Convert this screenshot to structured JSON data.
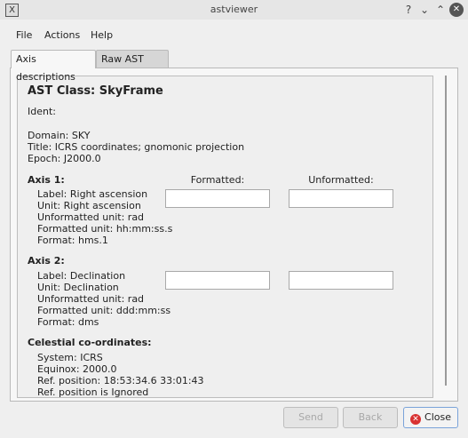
{
  "window": {
    "title": "astviewer",
    "app_icon_glyph": "X",
    "help_glyph": "?",
    "minimize_glyph": "⌄",
    "maximize_glyph": "⌃",
    "close_glyph": "✕"
  },
  "menubar": {
    "items": [
      "File",
      "Actions",
      "Help"
    ]
  },
  "tabs": [
    {
      "label": "Axis descriptions",
      "active": true
    },
    {
      "label": "Raw AST data",
      "active": false
    }
  ],
  "content": {
    "class_title": "AST Class: SkyFrame",
    "ident": "Ident:",
    "domain": "Domain: SKY",
    "title": "Title: ICRS coordinates; gnomonic projection",
    "epoch": "Epoch: J2000.0",
    "col_formatted": "Formatted:",
    "col_unformatted": "Unformatted:",
    "axis1": {
      "heading": "Axis 1:",
      "lines": [
        "Label: Right ascension",
        "Unit: Right ascension",
        "Unformatted unit: rad",
        "Formatted unit: hh:mm:ss.s",
        "Format: hms.1"
      ],
      "formatted_value": "",
      "unformatted_value": ""
    },
    "axis2": {
      "heading": "Axis 2:",
      "lines": [
        "Label: Declination",
        "Unit: Declination",
        "Unformatted unit: rad",
        "Formatted unit: ddd:mm:ss",
        "Format: dms"
      ],
      "formatted_value": "",
      "unformatted_value": ""
    },
    "celestial": {
      "heading": "Celestial co-ordinates:",
      "lines": [
        "System: ICRS",
        "Equinox: 2000.0",
        "Ref. position: 18:53:34.6 33:01:43",
        "Ref. position is Ignored"
      ]
    }
  },
  "buttons": {
    "send": "Send",
    "back": "Back",
    "close": "Close",
    "close_icon_glyph": "✕"
  },
  "colors": {
    "close_icon": "#d93232",
    "focus_border": "#7aa3d9"
  }
}
